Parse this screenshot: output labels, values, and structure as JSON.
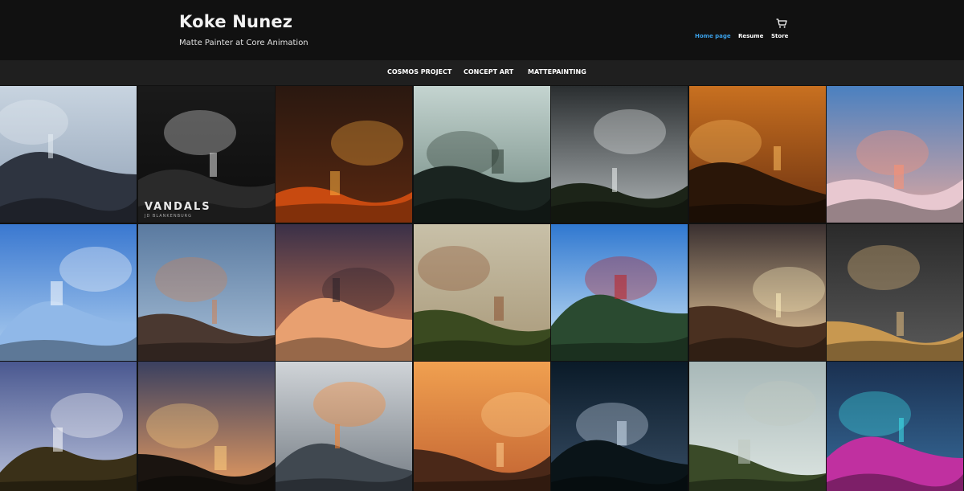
{
  "header": {
    "title": "Koke Nunez",
    "subtitle": "Matte Painter at Core Animation",
    "nav": [
      {
        "label": "Home page",
        "active": true
      },
      {
        "label": "Resume",
        "active": false
      },
      {
        "label": "Store",
        "active": false
      }
    ],
    "cart_icon": "shopping-cart-icon",
    "accent_color": "#3aa0e8"
  },
  "subnav": {
    "items": [
      {
        "label": "COSMOS PROJECT"
      },
      {
        "label": "CONCEPT ART"
      },
      {
        "label": "MATTEPAINTING"
      }
    ]
  },
  "gallery": {
    "rows": 3,
    "columns": 7,
    "tiles": [
      {
        "name": "foggy-giants",
        "sky": [
          "#c8d4e0",
          "#8fa0b5"
        ],
        "ground": "#2e3440",
        "accent": "#e8eef4"
      },
      {
        "name": "vandals-statue",
        "sky": [
          "#1a1a1a",
          "#0d0d0d"
        ],
        "ground": "#2a2a2a",
        "accent": "#e0e0e0",
        "caption": "VANDALS",
        "caption_sub": "JD BLANKENBURG"
      },
      {
        "name": "astronaut-lava",
        "sky": [
          "#2a1810",
          "#5a2810"
        ],
        "ground": "#c84a10",
        "accent": "#ffb040"
      },
      {
        "name": "windy-bridge",
        "sky": [
          "#c4d4d0",
          "#708880"
        ],
        "ground": "#1a2420",
        "accent": "#2a3830"
      },
      {
        "name": "storm-pagoda",
        "sky": [
          "#2a2e30",
          "#b0b6b8"
        ],
        "ground": "#1c2418",
        "accent": "#f0f4f4"
      },
      {
        "name": "amber-canyon",
        "sky": [
          "#c87020",
          "#6a3010"
        ],
        "ground": "#2a1608",
        "accent": "#ffc060"
      },
      {
        "name": "cloud-giant",
        "sky": [
          "#4a80c0",
          "#e0a8a0"
        ],
        "ground": "#e8c8d0",
        "accent": "#ff9070"
      },
      {
        "name": "sky-piano",
        "sky": [
          "#3a78d0",
          "#b0d0f0"
        ],
        "ground": "#90b8e8",
        "accent": "#ffffff"
      },
      {
        "name": "mountain-peak",
        "sky": [
          "#5a7aa0",
          "#a8c0d8"
        ],
        "ground": "#4a3830",
        "accent": "#d08050"
      },
      {
        "name": "cloud-ship",
        "sky": [
          "#3a3048",
          "#d07850"
        ],
        "ground": "#e8a070",
        "accent": "#2a2028"
      },
      {
        "name": "jungle-temple",
        "sky": [
          "#c8c0a8",
          "#a89878"
        ],
        "ground": "#3a4a20",
        "accent": "#8a5030"
      },
      {
        "name": "crystal-city",
        "sky": [
          "#3078d0",
          "#d0e8f8"
        ],
        "ground": "#2a4a30",
        "accent": "#c02020"
      },
      {
        "name": "dusk-valley",
        "sky": [
          "#3a3030",
          "#f0d0a0"
        ],
        "ground": "#4a3020",
        "accent": "#fff0c0"
      },
      {
        "name": "desert-pyramids",
        "sky": [
          "#2a2a2a",
          "#5a5a5a"
        ],
        "ground": "#c89850",
        "accent": "#e8c080"
      },
      {
        "name": "dragon-castle",
        "sky": [
          "#4a5890",
          "#c0c8e0"
        ],
        "ground": "#3a3018",
        "accent": "#ffffff"
      },
      {
        "name": "sunset-ridge",
        "sky": [
          "#3a4060",
          "#f0a060"
        ],
        "ground": "#1a1410",
        "accent": "#ffd080"
      },
      {
        "name": "space-fleet",
        "sky": [
          "#d0d4d8",
          "#707880"
        ],
        "ground": "#404850",
        "accent": "#ff8020"
      },
      {
        "name": "cliff-fortress",
        "sky": [
          "#f0a050",
          "#c06030"
        ],
        "ground": "#4a2818",
        "accent": "#ffd090"
      },
      {
        "name": "night-warrior",
        "sky": [
          "#0a1a28",
          "#3a5068"
        ],
        "ground": "#0a1418",
        "accent": "#d0e0f0"
      },
      {
        "name": "windmill-hill",
        "sky": [
          "#a8b8b8",
          "#e0e8e4"
        ],
        "ground": "#3a4a28",
        "accent": "#c0c8c0"
      },
      {
        "name": "neon-bridge",
        "sky": [
          "#1a3050",
          "#3a70a0"
        ],
        "ground": "#c030a0",
        "accent": "#40e8f0"
      }
    ]
  }
}
